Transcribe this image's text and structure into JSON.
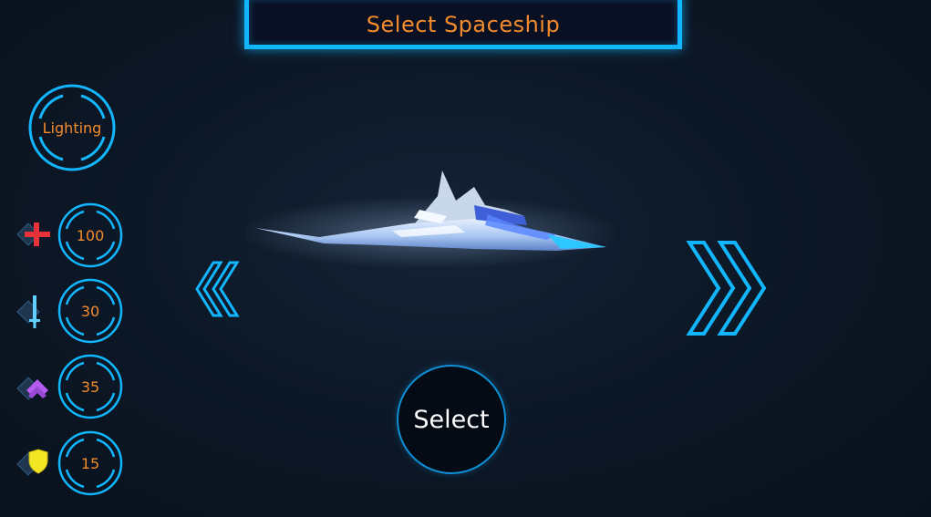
{
  "header": {
    "title": "Select Spaceship"
  },
  "ship": {
    "name_label": "Lighting"
  },
  "stats": [
    {
      "name": "health",
      "value": "100",
      "icon": "red-cross-icon"
    },
    {
      "name": "damage",
      "value": "30",
      "icon": "sword-icon"
    },
    {
      "name": "speed",
      "value": "35",
      "icon": "purple-chevron-icon"
    },
    {
      "name": "shield",
      "value": "15",
      "icon": "yellow-shield-icon"
    }
  ],
  "controls": {
    "select_label": "Select",
    "prev_icon": "double-chevron-left-icon",
    "next_icon": "double-chevron-right-icon"
  },
  "colors": {
    "accent": "#12b6ff",
    "text_orange": "#f28b2c",
    "background": "#0b1421"
  }
}
